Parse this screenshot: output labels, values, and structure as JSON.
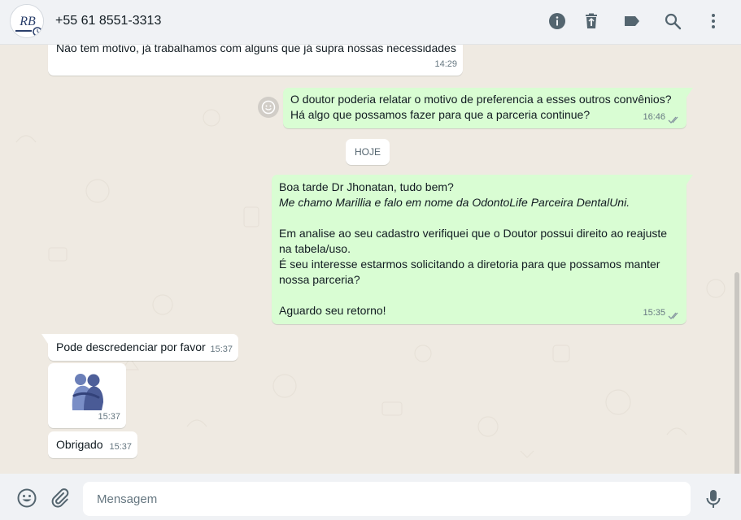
{
  "header": {
    "contact_name": "+55 61 8551-3313",
    "avatar_text": "RB"
  },
  "messages": {
    "m0": {
      "text": "Não tem motivo, já trabalhamos com alguns que já supra nossas necessidades",
      "time": "14:29"
    },
    "m1": {
      "line1": "O doutor poderia relatar o motivo de preferencia a esses outros convênios?",
      "line2": "Há algo que possamos fazer para que a parceria continue?",
      "time": "16:46"
    },
    "m2": {
      "line1": "Boa tarde Dr Jhonatan, tudo bem?",
      "line2": "Me chamo Marillia e falo em nome da OdontoLife Parceira DentalUni.",
      "line3": "Em analise ao seu cadastro verifiquei que o Doutor possui direito ao reajuste",
      "line4": "na tabela/uso.",
      "line5": "É seu interesse estarmos solicitando a diretoria para que possamos manter",
      "line6": "nossa parceria?",
      "line7": "Aguardo seu retorno!",
      "time": "15:35"
    },
    "m3": {
      "text": "Pode descredenciar por favor",
      "time": "15:37"
    },
    "m4": {
      "time": "15:37"
    },
    "m5": {
      "text": "Obrigado",
      "time": "15:37"
    }
  },
  "date_divider": "HOJE",
  "composer": {
    "placeholder": "Mensagem"
  },
  "colors": {
    "outgoing": "#d9fdd3",
    "incoming": "#ffffff",
    "background": "#efeae2",
    "header": "#f0f2f5",
    "read_ticks": "#8696a0"
  },
  "icons": [
    "info-icon",
    "delete-icon",
    "label-icon",
    "search-icon",
    "menu-icon",
    "emoji-icon",
    "attach-icon",
    "mic-icon",
    "ticks-icon",
    "hug-sticker-icon"
  ]
}
